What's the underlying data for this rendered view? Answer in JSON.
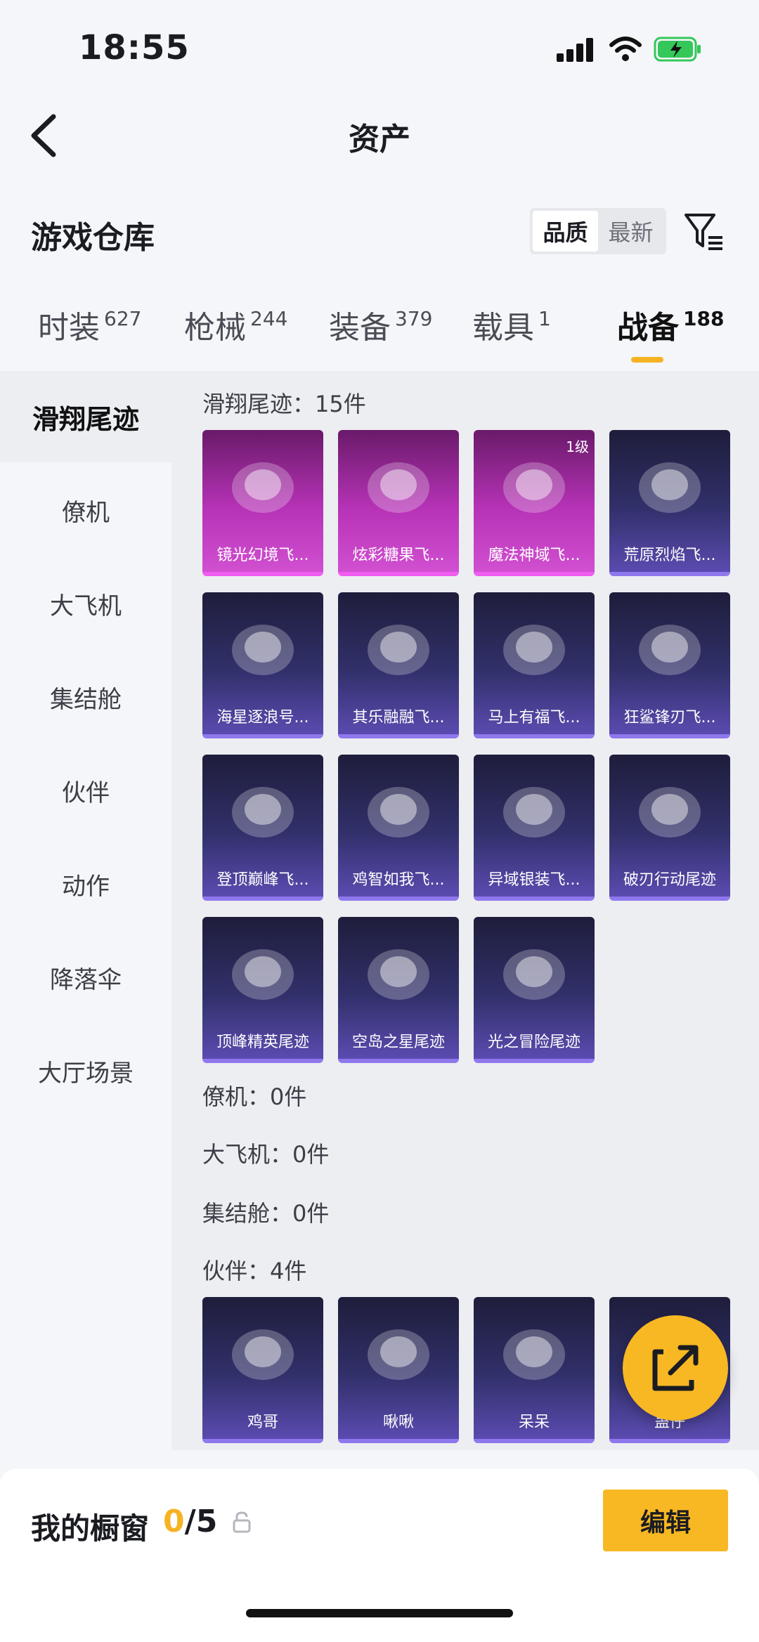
{
  "status": {
    "time": "18:55"
  },
  "nav": {
    "title": "资产"
  },
  "header": {
    "title": "游戏仓库",
    "sort_options": [
      "品质",
      "最新"
    ]
  },
  "tabs": [
    {
      "label": "时装",
      "count": "627"
    },
    {
      "label": "枪械",
      "count": "244"
    },
    {
      "label": "装备",
      "count": "379"
    },
    {
      "label": "载具",
      "count": "1"
    },
    {
      "label": "战备",
      "count": "188"
    }
  ],
  "sidebar": {
    "items": [
      "滑翔尾迹",
      "僚机",
      "大飞机",
      "集结舱",
      "伙伴",
      "动作",
      "降落伞",
      "大厅场景"
    ]
  },
  "groups": {
    "glide": {
      "title": "滑翔尾迹：15件",
      "items": [
        {
          "label": "镜光幻境飞...",
          "tier": ""
        },
        {
          "label": "炫彩糖果飞...",
          "tier": ""
        },
        {
          "label": "魔法神域飞...",
          "tier": "1级"
        },
        {
          "label": "荒原烈焰飞...",
          "tier": ""
        },
        {
          "label": "海星逐浪号...",
          "tier": ""
        },
        {
          "label": "其乐融融飞...",
          "tier": ""
        },
        {
          "label": "马上有福飞...",
          "tier": ""
        },
        {
          "label": "狂鲨锋刃飞...",
          "tier": ""
        },
        {
          "label": "登顶巅峰飞...",
          "tier": ""
        },
        {
          "label": "鸡智如我飞...",
          "tier": ""
        },
        {
          "label": "异域银装飞...",
          "tier": ""
        },
        {
          "label": "破刃行动尾迹",
          "tier": ""
        },
        {
          "label": "顶峰精英尾迹",
          "tier": ""
        },
        {
          "label": "空岛之星尾迹",
          "tier": ""
        },
        {
          "label": "光之冒险尾迹",
          "tier": ""
        }
      ]
    },
    "wingman": {
      "title": "僚机：0件"
    },
    "plane": {
      "title": "大飞机：0件"
    },
    "capsule": {
      "title": "集结舱：0件"
    },
    "partner": {
      "title": "伙伴：4件",
      "items": [
        {
          "label": "鸡哥"
        },
        {
          "label": "啾啾"
        },
        {
          "label": "呆呆"
        },
        {
          "label": "蛊仔"
        }
      ]
    }
  },
  "bottom": {
    "label": "我的橱窗",
    "current": "0",
    "max": "/5",
    "edit": "编辑"
  },
  "colors": {
    "accent": "#f8b823",
    "epic": "#d14fd1",
    "rare": "#8f78ee"
  }
}
